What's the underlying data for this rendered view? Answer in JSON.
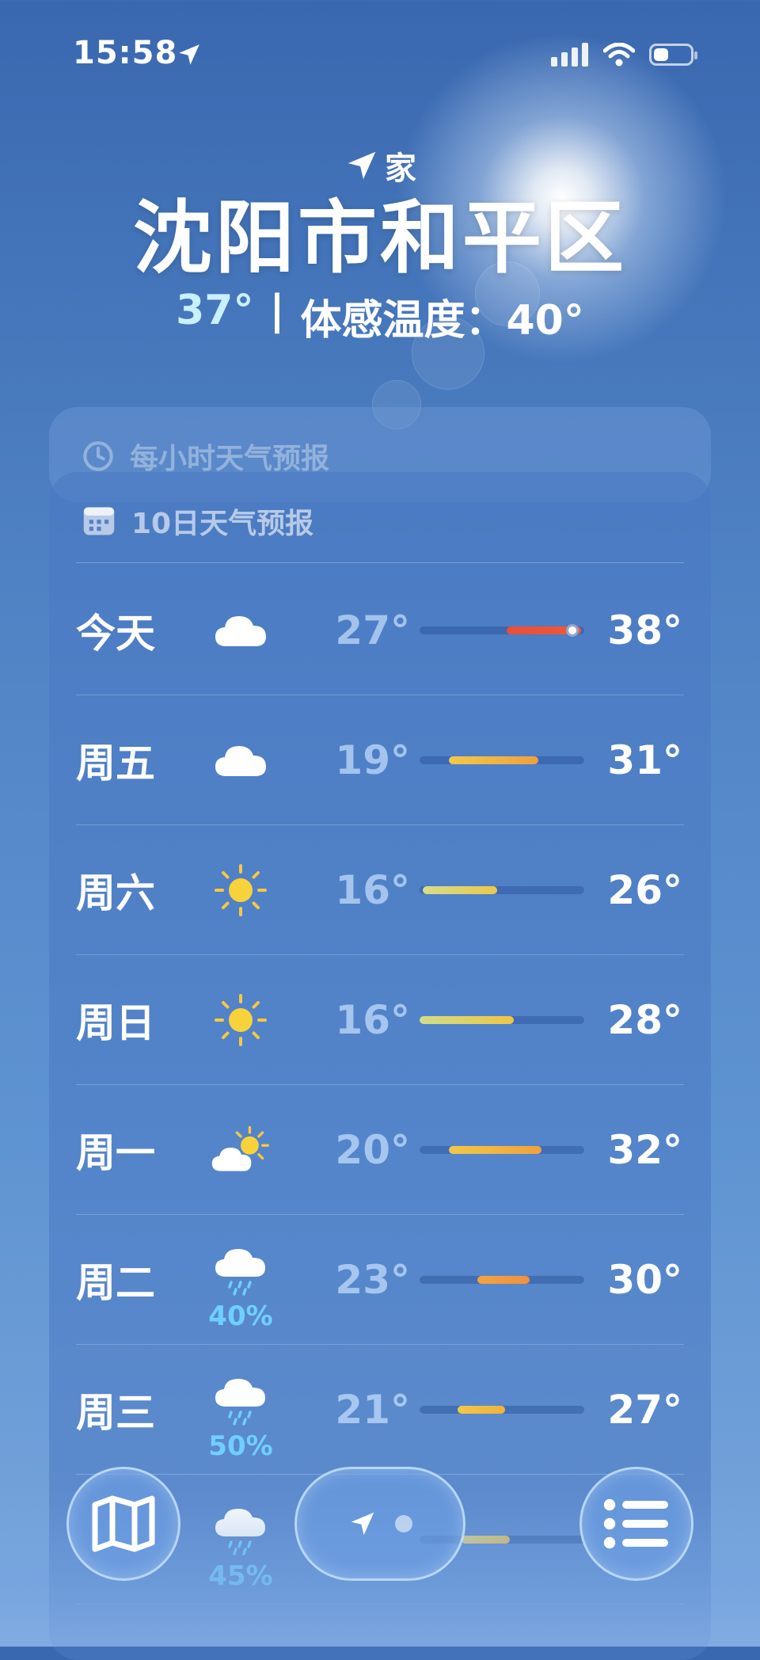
{
  "status_bar": {
    "time": "15:58"
  },
  "location": {
    "home_label": "家",
    "city": "沈阳市和平区",
    "current_temp": "37°",
    "divider": "|",
    "feels_like": "体感温度：40°"
  },
  "hourly": {
    "title": "每小时天气预报"
  },
  "daily": {
    "title": "10日天气预报",
    "days": [
      {
        "day": "今天",
        "icon": "cloud-icon",
        "precip": "",
        "low": "27°",
        "high": "38°",
        "range": [
          0.53,
          0.98
        ],
        "current": 0.93,
        "colors": [
          "#e8503a",
          "#f0583a"
        ]
      },
      {
        "day": "周五",
        "icon": "cloud-icon",
        "precip": "",
        "low": "19°",
        "high": "31°",
        "range": [
          0.18,
          0.72
        ],
        "colors": [
          "#f2c84a",
          "#f0a040"
        ]
      },
      {
        "day": "周六",
        "icon": "sun-icon",
        "precip": "",
        "low": "16°",
        "high": "26°",
        "range": [
          0.02,
          0.47
        ],
        "colors": [
          "#d6dd8a",
          "#ecc84a"
        ]
      },
      {
        "day": "周日",
        "icon": "sun-icon",
        "precip": "",
        "low": "16°",
        "high": "28°",
        "range": [
          0.0,
          0.57
        ],
        "colors": [
          "#d0dd88",
          "#f0c444"
        ]
      },
      {
        "day": "周一",
        "icon": "partly-sunny-icon",
        "precip": "",
        "low": "20°",
        "high": "32°",
        "range": [
          0.18,
          0.74
        ],
        "colors": [
          "#f2c848",
          "#f0a040"
        ]
      },
      {
        "day": "周二",
        "icon": "rain-cloud-icon",
        "precip": "40%",
        "low": "23°",
        "high": "30°",
        "range": [
          0.35,
          0.67
        ],
        "colors": [
          "#f2a440",
          "#f09040"
        ]
      },
      {
        "day": "周三",
        "icon": "rain-cloud-icon",
        "precip": "50%",
        "low": "21°",
        "high": "27°",
        "range": [
          0.23,
          0.52
        ],
        "colors": [
          "#f2c848",
          "#f0b040"
        ]
      },
      {
        "day": "",
        "icon": "rain-cloud-icon",
        "precip": "45%",
        "low": "",
        "high": "",
        "range": [
          0.25,
          0.55
        ],
        "colors": [
          "#d8d088",
          "#e0c060"
        ]
      }
    ]
  },
  "toolbar": {
    "map_icon": "map-icon",
    "location_icon": "location-arrow-icon",
    "list_icon": "list-icon"
  }
}
